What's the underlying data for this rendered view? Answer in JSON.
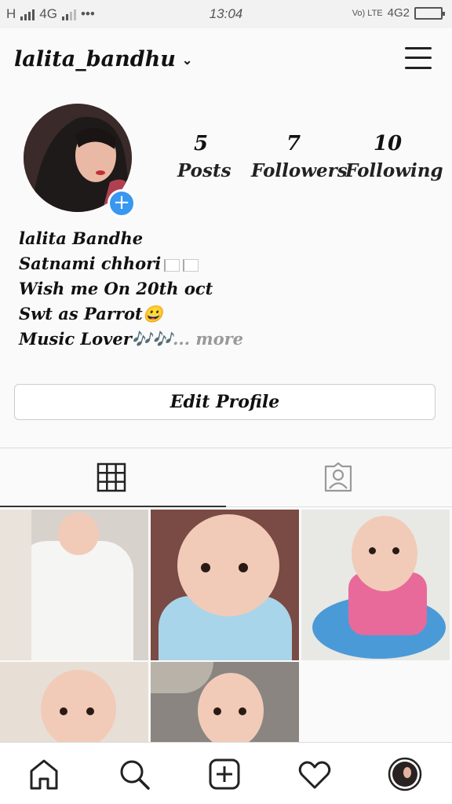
{
  "status_bar": {
    "left_text": "H",
    "network": "4G",
    "dots": "•••",
    "time": "13:04",
    "right_network": "4G2",
    "volte": "Vo) LTE"
  },
  "header": {
    "username": "lalita_bandhu",
    "chevron": "⌄",
    "menu_icon": "hamburger-icon"
  },
  "profile": {
    "add_icon": "+",
    "stats": [
      {
        "value": "5",
        "label": "Posts"
      },
      {
        "value": "7",
        "label": "Followers"
      },
      {
        "value": "10",
        "label": "Following"
      }
    ],
    "bio": {
      "name": "lalita Bandhe",
      "line1": "Satnami chhori",
      "line2": "Wish me On 20th oct",
      "line3": "Swt as Parrot",
      "line3_emoji": "😀",
      "line4": "Music Lover",
      "line4_emoji": "🎶🎶",
      "more": "... more"
    },
    "edit_button": "Edit Profile"
  },
  "tabs": [
    {
      "name": "grid",
      "icon": "grid-icon",
      "active": true
    },
    {
      "name": "tagged",
      "icon": "tagged-photos-icon",
      "active": false
    }
  ],
  "bottom_nav": [
    {
      "icon": "home-icon"
    },
    {
      "icon": "search-icon"
    },
    {
      "icon": "add-post-icon"
    },
    {
      "icon": "heart-icon"
    },
    {
      "icon": "profile-avatar-icon"
    }
  ],
  "colors": {
    "accent_blue": "#3897f0",
    "background": "#fafafa"
  }
}
